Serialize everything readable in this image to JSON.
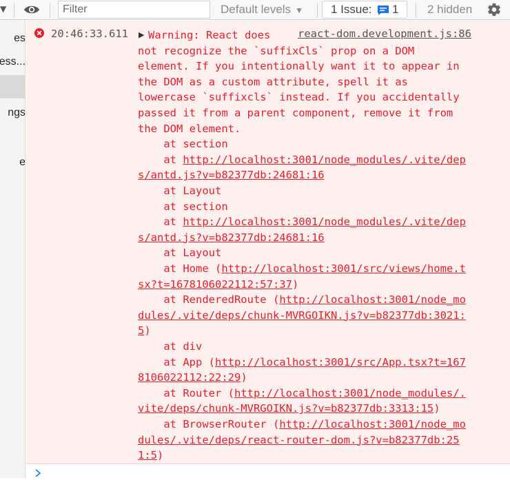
{
  "toolbar": {
    "filter_placeholder": "Filter",
    "levels_label": "Default levels",
    "issues_label": "1 Issue:",
    "issues_count": "1",
    "hidden_label": "2 hidden"
  },
  "sidebar": {
    "items": [
      "es",
      "ess...",
      "",
      "ngs",
      "e"
    ]
  },
  "message": {
    "timestamp": "20:46:33.611",
    "source": "react-dom.development.js:86",
    "lines": [
      {
        "text": "Warning: React does"
      },
      {
        "text": "not recognize the `suffixCls` prop on a DOM"
      },
      {
        "text": "element. If you intentionally want it to appear in"
      },
      {
        "text": "the DOM as a custom attribute, spell it as"
      },
      {
        "text": "lowercase `suffixcls` instead. If you accidentally"
      },
      {
        "text": "passed it from a parent component, remove it from"
      },
      {
        "text": "the DOM element."
      },
      {
        "text": "    at section"
      },
      {
        "text": "    at ",
        "link": "http://localhost:3001/node_modules/.vite/dep"
      },
      {
        "link": "s/antd.js?v=b82377db:24681:16"
      },
      {
        "text": "    at Layout"
      },
      {
        "text": "    at section"
      },
      {
        "text": "    at ",
        "link": "http://localhost:3001/node_modules/.vite/dep"
      },
      {
        "link": "s/antd.js?v=b82377db:24681:16"
      },
      {
        "text": "    at Layout"
      },
      {
        "text": "    at Home (",
        "link": "http://localhost:3001/src/views/home.t"
      },
      {
        "link": "sx?t=1678106022112:57:37",
        "after": ")"
      },
      {
        "text": "    at RenderedRoute (",
        "link": "http://localhost:3001/node_mo"
      },
      {
        "link": "dules/.vite/deps/chunk-MVRGOIKN.js?v=b82377db:3021:"
      },
      {
        "link": "5",
        "after": ")"
      },
      {
        "text": "    at div"
      },
      {
        "text": "    at App (",
        "link": "http://localhost:3001/src/App.tsx?t=167"
      },
      {
        "link": "8106022112:22:29",
        "after": ")"
      },
      {
        "text": "    at Router (",
        "link": "http://localhost:3001/node_modules/."
      },
      {
        "link": "vite/deps/chunk-MVRGOIKN.js?v=b82377db:3313:15",
        "after": ")"
      },
      {
        "text": "    at BrowserRouter (",
        "link": "http://localhost:3001/node_mo"
      },
      {
        "link": "dules/.vite/deps/react-router-dom.js?v=b82377db:25"
      },
      {
        "link": "1:5",
        "after": ")"
      }
    ]
  },
  "colors": {
    "error_text": "#e3202a",
    "error_bg": "#fff0f0",
    "accent": "#1a73e8"
  },
  "icons": [
    "chevron-down-icon",
    "eye-icon",
    "dropdown-arrow-icon",
    "issue-message-icon",
    "gear-icon",
    "error-circle-icon",
    "expand-triangle-icon",
    "prompt-chevron-icon"
  ]
}
